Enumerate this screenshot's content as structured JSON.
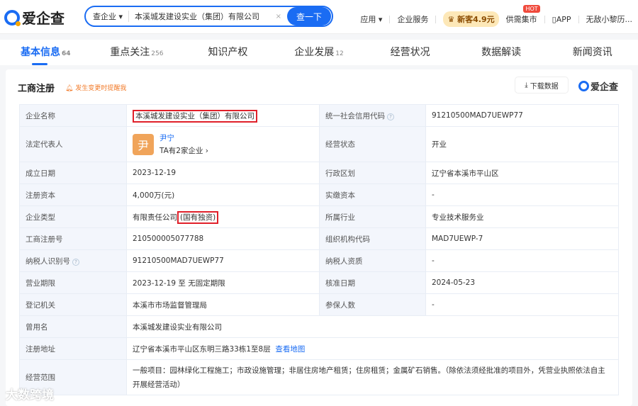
{
  "header": {
    "logo": "爱企查",
    "search_type": "查企业",
    "search_value": "本溪城发建设实业（集团）有限公司",
    "search_button": "查一下",
    "clear": "×",
    "nav": [
      "应用 ▾",
      "企业服务",
      "新客4.9元",
      "供需集市",
      "APP",
      "无敌小黎历..."
    ],
    "hot": "HOT"
  },
  "tabs": [
    {
      "label": "基本信息",
      "count": "64"
    },
    {
      "label": "重点关注",
      "count": "256"
    },
    {
      "label": "知识产权",
      "count": ""
    },
    {
      "label": "企业发展",
      "count": "12"
    },
    {
      "label": "经营状况",
      "count": ""
    },
    {
      "label": "数据解读",
      "count": ""
    },
    {
      "label": "新闻资讯",
      "count": ""
    }
  ],
  "section": {
    "title": "工商注册",
    "remind": "发生变更时提醒我",
    "download": "下载数据",
    "brand": "爱企查"
  },
  "info": {
    "name_label": "企业名称",
    "name": "本溪城发建设实业（集团）有限公司",
    "credit_label": "统一社会信用代码",
    "credit": "91210500MAD7UEWP77",
    "rep_label": "法定代表人",
    "rep_avatar": "尹",
    "rep_name": "尹宁",
    "rep_sub": "TA有2家企业 ›",
    "status_label": "经营状态",
    "status": "开业",
    "date_label": "成立日期",
    "date": "2023-12-19",
    "region_label": "行政区划",
    "region": "辽宁省本溪市平山区",
    "capital_label": "注册资本",
    "capital": "4,000万(元)",
    "paid_label": "实缴资本",
    "paid": "-",
    "type_label": "企业类型",
    "type_a": "有限责任公司",
    "type_b": "(国有独资)",
    "industry_label": "所属行业",
    "industry": "专业技术服务业",
    "regno_label": "工商注册号",
    "regno": "210500005077788",
    "org_label": "组织机构代码",
    "org": "MAD7UEWP-7",
    "tax_label": "纳税人识别号",
    "tax": "91210500MAD7UEWP77",
    "taxq_label": "纳税人资质",
    "taxq": "-",
    "term_label": "营业期限",
    "term": "2023-12-19 至 无固定期限",
    "approve_label": "核准日期",
    "approve": "2024-05-23",
    "authority_label": "登记机关",
    "authority": "本溪市市场监督管理局",
    "insured_label": "参保人数",
    "insured": "-",
    "former_label": "曾用名",
    "former": "本溪城发建设实业有限公司",
    "addr_label": "注册地址",
    "addr": "辽宁省本溪市平山区东明三路33栋1至8层",
    "map": "查看地图",
    "scope_label": "经营范围",
    "scope": "一般项目：园林绿化工程施工；市政设施管理；非居住房地产租赁；住房租赁；金属矿石销售。（除依法须经批准的项目外，凭营业执照依法自主开展经营活动）"
  },
  "watermark": "大数跨境"
}
